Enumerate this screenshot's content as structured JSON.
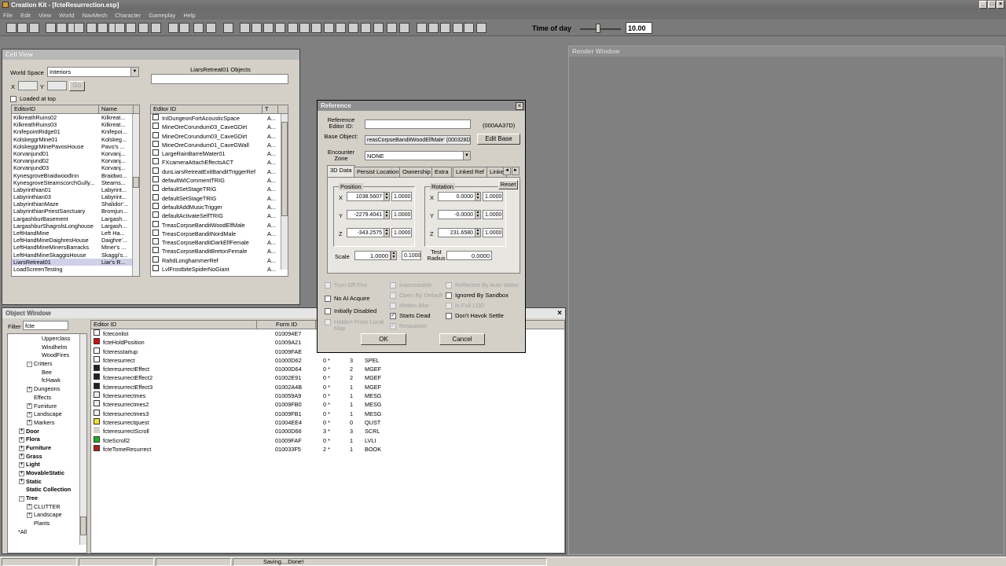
{
  "app": {
    "title": "Creation Kit - [fcteResurrection.esp]",
    "menu": [
      "File",
      "Edit",
      "View",
      "World",
      "NavMesh",
      "Character",
      "Gameplay",
      "Help"
    ],
    "time_of_day_label": "Time of day",
    "time_of_day_value": "10.00",
    "window_buttons": [
      "_",
      "□",
      "×"
    ]
  },
  "cell_view": {
    "title": "Cell View",
    "worldspace_label": "World Space",
    "worldspace_value": "Interiors",
    "x_label": "X",
    "y_label": "Y",
    "go_label": "Go",
    "loaded_at_top": "Loaded at top",
    "objects_title": "LiarsRetreat01 Objects",
    "cells_headers": [
      "EditorID",
      "Name"
    ],
    "cells": [
      [
        "KilkreathRuins02",
        "Kilkreat..."
      ],
      [
        "KilkreathRuins03",
        "Kilkreat..."
      ],
      [
        "KnifepointRidge01",
        "Knifepoi..."
      ],
      [
        "KolskeggrMine01",
        "Kolskeg..."
      ],
      [
        "KolskeggrMinePavosHouse",
        "Pavo's ..."
      ],
      [
        "Korvanjund01",
        "Korvanj..."
      ],
      [
        "Korvanjund02",
        "Korvanj..."
      ],
      [
        "Korvanjund03",
        "Korvanj..."
      ],
      [
        "KynesgroveBraidwoodInn",
        "Braidwo..."
      ],
      [
        "KynesgroveSteamscorchGully...",
        "Steams..."
      ],
      [
        "Labyrinthian01",
        "Labyrint..."
      ],
      [
        "Labyrinthian03",
        "Labyrint..."
      ],
      [
        "LabyrinthianMaze",
        "Shalidor'..."
      ],
      [
        "LabyrinthianPriestSanctuary",
        "Bromjun..."
      ],
      [
        "LargashburBasement",
        "Largash..."
      ],
      [
        "LargashburShagrolsLonghouse",
        "Largash..."
      ],
      [
        "LeftHandMine",
        "Left Ha..."
      ],
      [
        "LeftHandMineDaighresHouse",
        "Daighre'..."
      ],
      [
        "LeftHandMineMinersBarracks",
        "Miner's ..."
      ],
      [
        "LeftHandMineSkaggisHouse",
        "Skaggi's..."
      ],
      [
        "LiarsRetreat01",
        "Liar's R..."
      ],
      [
        "LoadScreenTesting",
        ""
      ]
    ],
    "objects_headers": [
      "Editor ID",
      "T"
    ],
    "objects": [
      [
        "InIDungeonFortAcousticSpace",
        "A..."
      ],
      [
        "MineOreCorundum03_CaveGDirt",
        "A..."
      ],
      [
        "MineOreCorundum03_CaveGDirt",
        "A..."
      ],
      [
        "MineOreCorundum01_CaveGWall",
        "A..."
      ],
      [
        "LargeRainBarrelWater01",
        "A..."
      ],
      [
        "FXcameraAttachEffectsACT",
        "A..."
      ],
      [
        "dunLiarsRetreatExitBanditTriggerRef",
        "A..."
      ],
      [
        "defaultWICommentTRIG",
        "A..."
      ],
      [
        "defaultSetStageTRIG",
        "A..."
      ],
      [
        "defaultSetStageTRIG",
        "A..."
      ],
      [
        "defaultAddMusicTrigger",
        "A..."
      ],
      [
        "defaultActivateSelfTRIG",
        "A..."
      ],
      [
        "TreasCorpseBanditWoodElfMale",
        "A..."
      ],
      [
        "TreasCorpseBanditNordMale",
        "A..."
      ],
      [
        "TreasCorpseBanditDarkElfFemale",
        "A..."
      ],
      [
        "TreasCorpseBanditBretonFemale",
        "A..."
      ],
      [
        "RahdLonghammerRef",
        "A..."
      ],
      [
        "LvlFrostbiteSpiderNoGiant",
        "A..."
      ]
    ]
  },
  "object_window": {
    "title": "Object Window",
    "filter_label": "Filter",
    "filter_value": "fcte",
    "tree": [
      {
        "label": "Upperclass",
        "indent": 3,
        "exp": "",
        "bold": false
      },
      {
        "label": "Windhelm",
        "indent": 3,
        "exp": "",
        "bold": false
      },
      {
        "label": "WoodFires",
        "indent": 3,
        "exp": "",
        "bold": false
      },
      {
        "label": "Critters",
        "indent": 2,
        "exp": "-",
        "bold": false
      },
      {
        "label": "Bee",
        "indent": 3,
        "exp": "",
        "bold": false
      },
      {
        "label": "fcHawk",
        "indent": 3,
        "exp": "",
        "bold": false
      },
      {
        "label": "Dungeons",
        "indent": 2,
        "exp": "+",
        "bold": false
      },
      {
        "label": "Effects",
        "indent": 2,
        "exp": "",
        "bold": false
      },
      {
        "label": "Furniture",
        "indent": 2,
        "exp": "+",
        "bold": false
      },
      {
        "label": "Landscape",
        "indent": 2,
        "exp": "+",
        "bold": false
      },
      {
        "label": "Markers",
        "indent": 2,
        "exp": "+",
        "bold": false
      },
      {
        "label": "Door",
        "indent": 1,
        "exp": "+",
        "bold": true
      },
      {
        "label": "Flora",
        "indent": 1,
        "exp": "+",
        "bold": true
      },
      {
        "label": "Furniture",
        "indent": 1,
        "exp": "+",
        "bold": true
      },
      {
        "label": "Grass",
        "indent": 1,
        "exp": "+",
        "bold": true
      },
      {
        "label": "Light",
        "indent": 1,
        "exp": "+",
        "bold": true
      },
      {
        "label": "MovableStatic",
        "indent": 1,
        "exp": "+",
        "bold": true
      },
      {
        "label": "Static",
        "indent": 1,
        "exp": "+",
        "bold": true
      },
      {
        "label": "Static Collection",
        "indent": 1,
        "exp": "",
        "bold": true
      },
      {
        "label": "Tree",
        "indent": 1,
        "exp": "-",
        "bold": true
      },
      {
        "label": "CLUTTER",
        "indent": 2,
        "exp": "+",
        "bold": false
      },
      {
        "label": "Landscape",
        "indent": 2,
        "exp": "+",
        "bold": false
      },
      {
        "label": "Plants",
        "indent": 2,
        "exp": "",
        "bold": false
      },
      {
        "label": "*All",
        "indent": 0,
        "exp": "",
        "bold": false
      }
    ],
    "headers": [
      "Editor ID",
      "Form ID",
      "",
      "",
      ""
    ],
    "rows": [
      {
        "icon": "script",
        "id": "fcteconlist",
        "form": "010094E7",
        "c": "",
        "n": "",
        "t": ""
      },
      {
        "icon": "red",
        "id": "fcteHoldPosition",
        "form": "01009A21",
        "c": "",
        "n": "",
        "t": ""
      },
      {
        "icon": "script",
        "id": "fcteresstartup",
        "form": "01009FAE",
        "c": "",
        "n": "",
        "t": ""
      },
      {
        "icon": "spell",
        "id": "fcteresurrect",
        "form": "01000D62",
        "c": "0 *",
        "n": "3",
        "t": "SPEL"
      },
      {
        "icon": "effect",
        "id": "fcteresurrectEffect",
        "form": "01000D64",
        "c": "0 *",
        "n": "2",
        "t": "MGEF"
      },
      {
        "icon": "effect",
        "id": "fcteresurrectEffect2",
        "form": "01002E91",
        "c": "0 *",
        "n": "2",
        "t": "MGEF"
      },
      {
        "icon": "effect",
        "id": "fcteresurrectEffect3",
        "form": "01002A4B",
        "c": "0 *",
        "n": "1",
        "t": "MGEF"
      },
      {
        "icon": "mesg",
        "id": "fcteresurrectmes",
        "form": "010059A9",
        "c": "0 *",
        "n": "1",
        "t": "MESG"
      },
      {
        "icon": "mesg",
        "id": "fcteresurrectmes2",
        "form": "01009FB0",
        "c": "0 *",
        "n": "1",
        "t": "MESG"
      },
      {
        "icon": "mesg",
        "id": "fcteresurrectmes3",
        "form": "01009FB1",
        "c": "0 *",
        "n": "1",
        "t": "MESG"
      },
      {
        "icon": "quest",
        "id": "fcteresurrectquest",
        "form": "01004EE4",
        "c": "0 *",
        "n": "0",
        "t": "QUST"
      },
      {
        "icon": "none",
        "id": "fcteresurrectScroll",
        "form": "01000D66",
        "c": "3 *",
        "n": "3",
        "t": "SCRL"
      },
      {
        "icon": "green",
        "id": "fcteScroll2",
        "form": "01009FAF",
        "c": "0 *",
        "n": "1",
        "t": "LVLI"
      },
      {
        "icon": "book",
        "id": "fcteTomeResurrect",
        "form": "010033F5",
        "c": "2 *",
        "n": "1",
        "t": "BOOK"
      }
    ]
  },
  "render_window": {
    "title": "Render Window"
  },
  "reference": {
    "title": "Reference",
    "editor_id_label": "Reference Editor ID:",
    "editor_id_value": "",
    "form_id": "(000AA37D)",
    "base_object_label": "Base Object:",
    "base_object_value": "reasCorpseBanditWoodElfMale' (000328D",
    "edit_base": "Edit Base",
    "encounter_zone_label": "Encounter Zone",
    "encounter_zone_value": "NONE",
    "tabs": [
      "3D Data",
      "Persist Location",
      "Ownership",
      "Extra",
      "Linked Ref",
      "Linke"
    ],
    "position_label": "Position",
    "rotation_label": "Rotation",
    "reset": "Reset",
    "pos": [
      {
        "axis": "X",
        "value": "1038.5607",
        "scale": "1.0000"
      },
      {
        "axis": "Y",
        "value": "-2279.4041",
        "scale": "1.0000"
      },
      {
        "axis": "Z",
        "value": "-343.2575",
        "scale": "1.0000"
      }
    ],
    "rot": [
      {
        "axis": "X",
        "value": "0.0000",
        "scale": "1.0000"
      },
      {
        "axis": "Y",
        "value": "-0.0000",
        "scale": "1.0000"
      },
      {
        "axis": "Z",
        "value": "231.6580",
        "scale": "1.0000"
      }
    ],
    "scale_label": "Scale",
    "scale_value": "1.0000",
    "scale_step": "0.1000",
    "test_radius_label": "Test Radius",
    "test_radius_value": "0.0000",
    "flags_col1": [
      {
        "label": "Turn Off Fire",
        "checked": false,
        "disabled": true
      },
      {
        "label": "No AI Acquire",
        "checked": false,
        "disabled": false
      },
      {
        "label": "Initially Disabled",
        "checked": false,
        "disabled": false
      },
      {
        "label": "Hidden From Local Map",
        "checked": false,
        "disabled": true
      }
    ],
    "flags_col2": [
      {
        "label": "Inaccessible",
        "checked": false,
        "disabled": true
      },
      {
        "label": "Open By Default",
        "checked": false,
        "disabled": true
      },
      {
        "label": "Motion Blur",
        "checked": false,
        "disabled": true
      },
      {
        "label": "Starts Dead",
        "checked": true,
        "disabled": false
      },
      {
        "label": "Respawns",
        "checked": true,
        "disabled": true
      }
    ],
    "flags_col3": [
      {
        "label": "Reflected By Auto Water",
        "checked": false,
        "disabled": true
      },
      {
        "label": "Ignored By Sandbox",
        "checked": false,
        "disabled": false
      },
      {
        "label": "Is Full LOD",
        "checked": false,
        "disabled": true
      },
      {
        "label": "Don't Havok Settle",
        "checked": false,
        "disabled": false
      }
    ],
    "ok": "OK",
    "cancel": "Cancel"
  },
  "status": {
    "message": "Saving....Done!"
  }
}
